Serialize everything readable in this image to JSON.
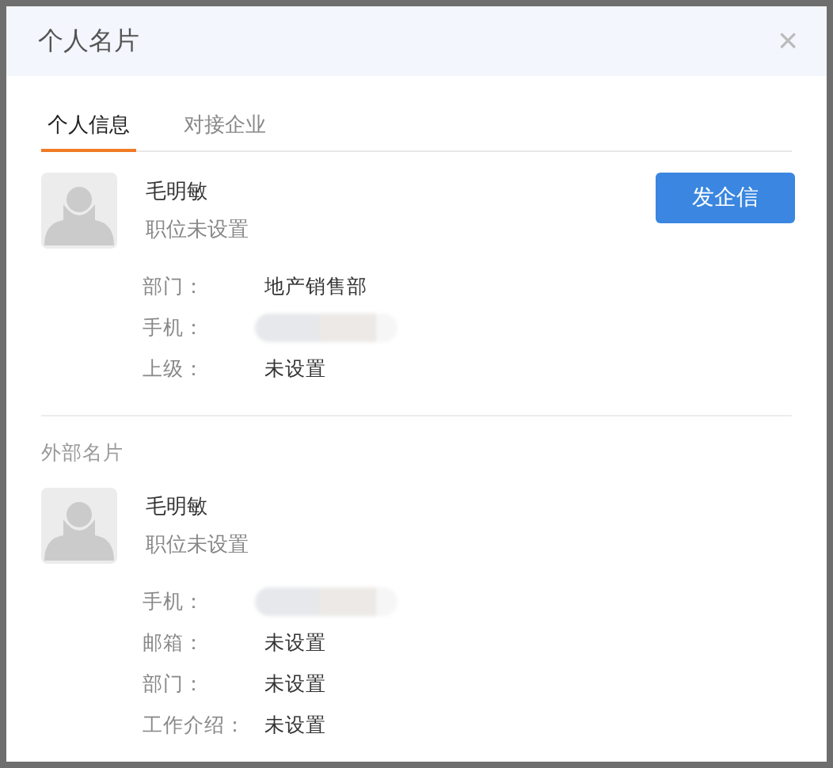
{
  "window": {
    "title": "个人名片",
    "close": "×"
  },
  "tabs": [
    {
      "label": "个人信息",
      "selected": true
    },
    {
      "label": "对接企业",
      "selected": false
    }
  ],
  "profile": {
    "name": "毛明敏",
    "position": "职位未设置",
    "button": "发企信",
    "fields": [
      {
        "label": "部门：",
        "kind": "text",
        "value": "地产销售部"
      },
      {
        "label": "手机：",
        "kind": "redacted"
      },
      {
        "label": "上级：",
        "kind": "text",
        "value": "未设置"
      }
    ]
  },
  "external_card": {
    "heading": "外部名片",
    "name": "毛明敏",
    "position": "职位未设置",
    "fields": [
      {
        "label": "手机：",
        "kind": "redacted"
      },
      {
        "label": "邮箱：",
        "kind": "text",
        "value": "未设置"
      },
      {
        "label": "部门：",
        "kind": "text",
        "value": "未设置"
      },
      {
        "label": "工作介绍：",
        "kind": "text",
        "value": "未设置"
      }
    ]
  }
}
